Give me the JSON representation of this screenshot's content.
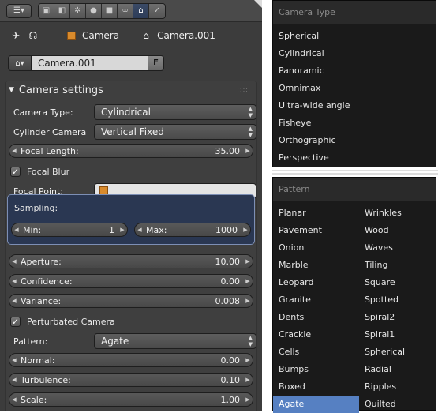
{
  "header": {
    "editor_icon": "properties-editor-icon",
    "context_tabs": [
      "render-icon",
      "scene-icon",
      "world-icon",
      "object-icon",
      "constraints-icon",
      "modifiers-icon",
      "data-icon",
      "material-icon"
    ],
    "active_tab": "data-icon"
  },
  "breadcrumb": {
    "object_label": "Camera",
    "data_label": "Camera.001"
  },
  "datablock": {
    "name": "Camera.001",
    "fake_user": "F"
  },
  "camera_settings": {
    "title": "Camera settings",
    "camera_type_label": "Camera Type:",
    "camera_type_value": "Cylindrical",
    "cylinder_camera_label": "Cylinder Camera",
    "cylinder_camera_value": "Vertical Fixed",
    "focal_length_label": "Focal Length:",
    "focal_length_value": "35.00",
    "focal_blur_label": "Focal Blur",
    "focal_point_label": "Focal Point:",
    "sampling_label": "Sampling:",
    "min_label": "Min:",
    "min_value": "1",
    "max_label": "Max:",
    "max_value": "1000",
    "aperture_label": "Aperture:",
    "aperture_value": "10.00",
    "confidence_label": "Confidence:",
    "confidence_value": "0.00",
    "variance_label": "Variance:",
    "variance_value": "0.008",
    "perturbated_label": "Perturbated Camera",
    "pattern_label": "Pattern:",
    "pattern_value": "Agate",
    "normal_label": "Normal:",
    "normal_value": "0.00",
    "turbulence_label": "Turbulence:",
    "turbulence_value": "0.10",
    "scale_label": "Scale:",
    "scale_value": "1.00"
  },
  "camera_type_menu": {
    "title": "Camera Type",
    "items": [
      "Spherical",
      "Cylindrical",
      "Panoramic",
      "Omnimax",
      "Ultra-wide angle",
      "Fisheye",
      "Orthographic",
      "Perspective"
    ]
  },
  "pattern_menu": {
    "title": "Pattern",
    "col1": [
      "Planar",
      "Pavement",
      "Onion",
      "Marble",
      "Leopard",
      "Granite",
      "Dents",
      "Crackle",
      "Cells",
      "Bumps",
      "Boxed",
      "Agate"
    ],
    "col2": [
      "Wrinkles",
      "Wood",
      "Waves",
      "Tiling",
      "Square",
      "Spotted",
      "Spiral2",
      "Spiral1",
      "Spherical",
      "Radial",
      "Ripples",
      "Quilted"
    ],
    "selected": "Agate"
  },
  "colors": {
    "panel_bg": "#3c3c3c",
    "sampling_bg": "#2a3752",
    "selected_bg": "#5680c2",
    "menu_bg": "#1a1a1a"
  }
}
